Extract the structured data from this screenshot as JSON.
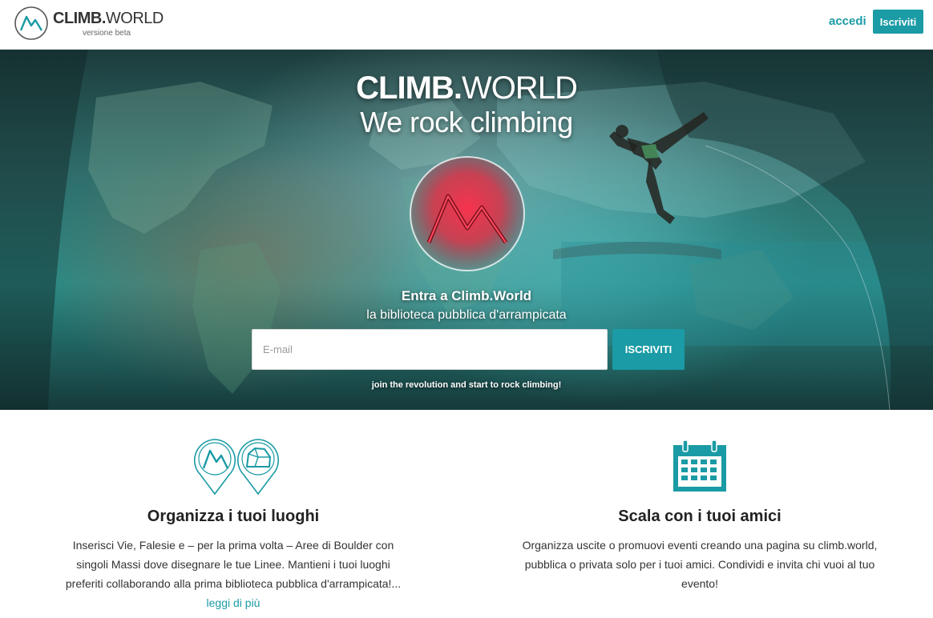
{
  "header": {
    "brand_bold": "CLIMB.",
    "brand_thin": "WORLD",
    "beta_label": "versione beta",
    "login_label": "accedi",
    "signup_label": "Iscriviti"
  },
  "hero": {
    "title_bold": "CLIMB.",
    "title_thin": "WORLD",
    "subtitle": "We rock climbing",
    "intro_line1": "Entra a Climb.World",
    "intro_line2": "la biblioteca pubblica d'arrampicata",
    "email_placeholder": "E-mail",
    "email_value": "",
    "cta_label": "ISCRIVITI",
    "tagline": "join the revolution and start to rock climbing!"
  },
  "features": [
    {
      "title": "Organizza i tuoi luoghi",
      "text": "Inserisci Vie, Falesie e – per la prima volta – Aree di Boulder con singoli Massi dove disegnare le tue Linee. Mantieni i tuoi luoghi preferiti collaborando alla prima biblioteca pubblica d'arrampicata!...",
      "link_label": "leggi di più",
      "icon": "map-pins-icon"
    },
    {
      "title": "Scala con i tuoi amici",
      "text": "Organizza uscite o promuovi eventi creando una pagina su climb.world, pubblica o privata solo per i tuoi amici. Condividi e invita chi vuoi al tuo evento!",
      "icon": "calendar-icon"
    }
  ],
  "colors": {
    "accent": "#1a9ba5",
    "emblem_red": "#e8213a",
    "text": "#222222"
  }
}
